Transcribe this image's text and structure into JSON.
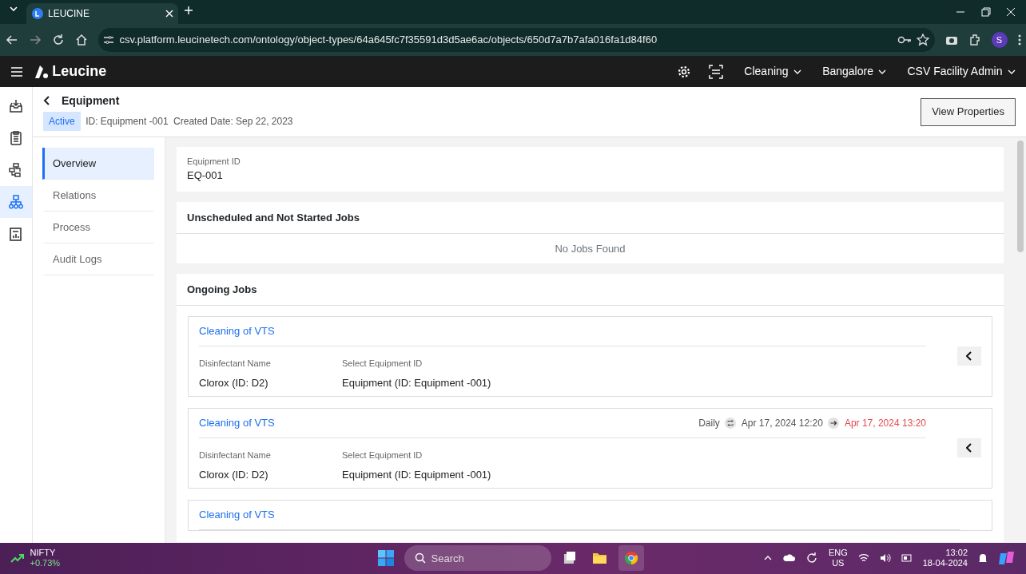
{
  "browser": {
    "tab_title": "LEUCINE",
    "url": "csv.platform.leucinetech.com/ontology/object-types/64a645fc7f35591d3d5ae6ac/objects/650d7a7b7afa016fa1d84f60",
    "profile_initial": "S"
  },
  "app_header": {
    "brand": "Leucine",
    "selectors": [
      "Cleaning",
      "Bangalore",
      "CSV Facility Admin"
    ]
  },
  "rail": [
    {
      "kind": "inbox",
      "selected": false
    },
    {
      "kind": "checklist",
      "selected": false
    },
    {
      "kind": "flow",
      "selected": false
    },
    {
      "kind": "hierarchy",
      "selected": true
    },
    {
      "kind": "reports",
      "selected": false
    }
  ],
  "page_header": {
    "title": "Equipment",
    "status": "Active",
    "id_text": "ID: Equipment -001",
    "created_text": "Created Date: Sep 22, 2023",
    "button": "View Properties"
  },
  "side_nav": [
    {
      "label": "Overview",
      "selected": true
    },
    {
      "label": "Relations",
      "selected": false
    },
    {
      "label": "Process",
      "selected": false
    },
    {
      "label": "Audit Logs",
      "selected": false
    }
  ],
  "equipment_id": {
    "label": "Equipment ID",
    "value": "EQ-001"
  },
  "unscheduled": {
    "title": "Unscheduled and Not Started Jobs",
    "empty_text": "No Jobs Found"
  },
  "ongoing": {
    "title": "Ongoing Jobs",
    "jobs": [
      {
        "title": "Cleaning of VTS",
        "fields": [
          {
            "label": "Disinfectant Name",
            "value": "Clorox (ID: D2)"
          },
          {
            "label": "Select Equipment ID",
            "value": "Equipment (ID: Equipment -001)"
          }
        ]
      },
      {
        "title": "Cleaning of VTS",
        "schedule": {
          "frequency": "Daily",
          "start": "Apr 17, 2024 12:20",
          "end": "Apr 17, 2024 13:20",
          "overdue": true
        },
        "fields": [
          {
            "label": "Disinfectant Name",
            "value": "Clorox (ID: D2)"
          },
          {
            "label": "Select Equipment ID",
            "value": "Equipment (ID: Equipment -001)"
          }
        ]
      },
      {
        "title": "Cleaning of VTS"
      }
    ]
  },
  "taskbar": {
    "ticker": {
      "name": "NIFTY",
      "change": "+0.73%"
    },
    "search_placeholder": "Search",
    "apps": [
      {
        "kind": "task-view",
        "selected": false
      },
      {
        "kind": "files",
        "selected": false
      },
      {
        "kind": "browser",
        "selected": true
      }
    ],
    "language": "ENG",
    "region": "US",
    "time": "13:02",
    "date": "18-04-2024"
  }
}
